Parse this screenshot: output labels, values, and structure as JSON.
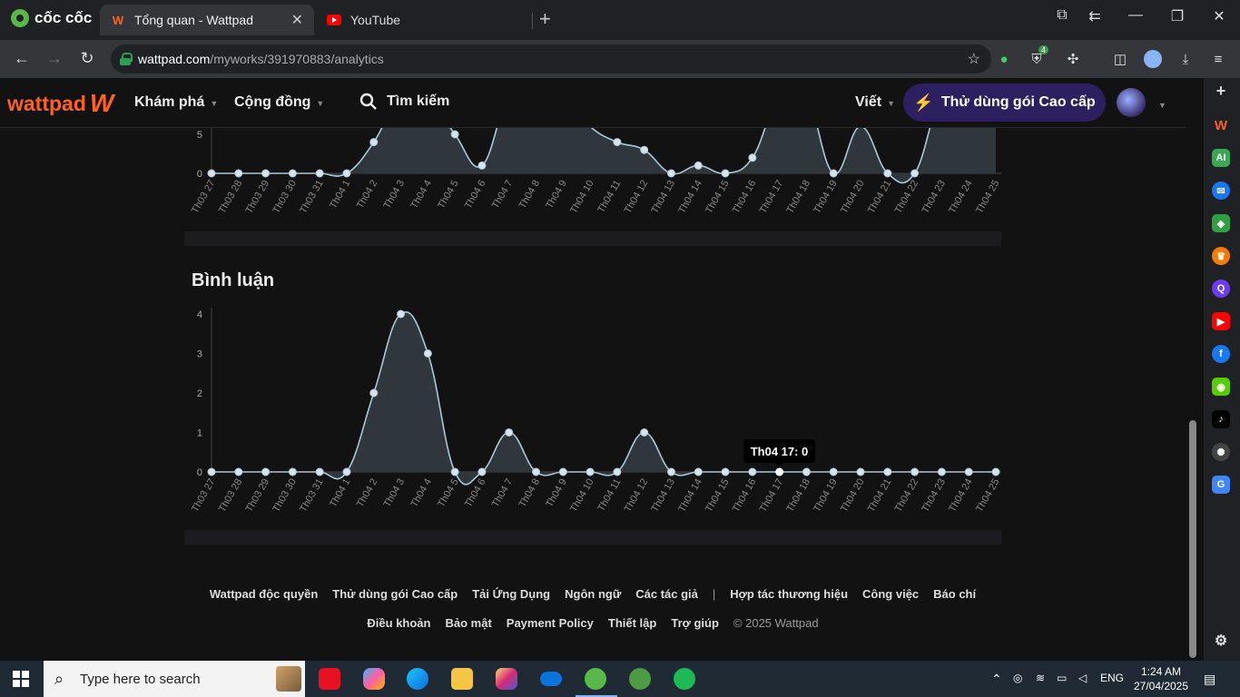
{
  "browser": {
    "brand": "cốc cốc",
    "tabs": [
      {
        "title": "Tổng quan - Wattpad",
        "icon": "wattpad-icon"
      },
      {
        "title": "YouTube",
        "icon": "youtube-icon"
      }
    ],
    "url_host": "wattpad.com",
    "url_path": "/myworks/391970883/analytics",
    "extension_badge": "4"
  },
  "wattpad": {
    "logo": "wattpad",
    "nav": {
      "explore": "Khám phá",
      "community": "Cộng đồng",
      "search": "Tìm kiếm",
      "write": "Viết",
      "premium": "Thử dùng gói Cao cấp"
    }
  },
  "charts": {
    "comments_title": "Bình luận",
    "tooltip": "Th04 17: 0"
  },
  "chart_data": [
    {
      "type": "area",
      "title": "",
      "categories": [
        "Th03 27",
        "Th03 28",
        "Th03 29",
        "Th03 30",
        "Th03 31",
        "Th04 1",
        "Th04 2",
        "Th04 3",
        "Th04 4",
        "Th04 5",
        "Th04 6",
        "Th04 7",
        "Th04 8",
        "Th04 9",
        "Th04 10",
        "Th04 11",
        "Th04 12",
        "Th04 13",
        "Th04 14",
        "Th04 15",
        "Th04 16",
        "Th04 17",
        "Th04 18",
        "Th04 19",
        "Th04 20",
        "Th04 21",
        "Th04 22",
        "Th04 23",
        "Th04 24",
        "Th04 25"
      ],
      "values": [
        0,
        0,
        0,
        0,
        0,
        0,
        4,
        10,
        10,
        5,
        1,
        10,
        10,
        10,
        6,
        4,
        3,
        0,
        1,
        0,
        2,
        10,
        10,
        0,
        6,
        0,
        0,
        10,
        10,
        10
      ],
      "yticks_visible": [
        0,
        5
      ],
      "note_visible": "upper portion cropped by header"
    },
    {
      "type": "area",
      "title": "Bình luận",
      "categories": [
        "Th03 27",
        "Th03 28",
        "Th03 29",
        "Th03 30",
        "Th03 31",
        "Th04 1",
        "Th04 2",
        "Th04 3",
        "Th04 4",
        "Th04 5",
        "Th04 6",
        "Th04 7",
        "Th04 8",
        "Th04 9",
        "Th04 10",
        "Th04 11",
        "Th04 12",
        "Th04 13",
        "Th04 14",
        "Th04 15",
        "Th04 16",
        "Th04 17",
        "Th04 18",
        "Th04 19",
        "Th04 20",
        "Th04 21",
        "Th04 22",
        "Th04 23",
        "Th04 24",
        "Th04 25"
      ],
      "values": [
        0,
        0,
        0,
        0,
        0,
        0,
        2,
        4,
        3,
        0,
        0,
        1,
        0,
        0,
        0,
        0,
        1,
        0,
        0,
        0,
        0,
        0,
        0,
        0,
        0,
        0,
        0,
        0,
        0,
        0
      ],
      "ylim": [
        0,
        4
      ],
      "yticks": [
        0,
        1,
        2,
        3,
        4
      ],
      "highlight": {
        "category": "Th04 17",
        "value": 0
      }
    }
  ],
  "footer": {
    "row1": [
      "Wattpad độc quyền",
      "Thử dùng gói Cao cấp",
      "Tải Ứng Dụng",
      "Ngôn ngữ",
      "Các tác giả",
      "|",
      "Hợp tác thương hiệu",
      "Công việc",
      "Báo chí"
    ],
    "row2": [
      "Điều khoản",
      "Bảo mật",
      "Payment Policy",
      "Thiết lập",
      "Trợ giúp",
      "© 2025 Wattpad"
    ]
  },
  "taskbar": {
    "search_placeholder": "Type here to search",
    "language": "ENG",
    "time": "1:24 AM",
    "date": "27/04/2025"
  },
  "colors": {
    "wattpad_orange": "#ff6122",
    "premium_bg": "#2d2060",
    "chart_line": "#a9c8d8",
    "chart_fill": "#2f363c"
  }
}
